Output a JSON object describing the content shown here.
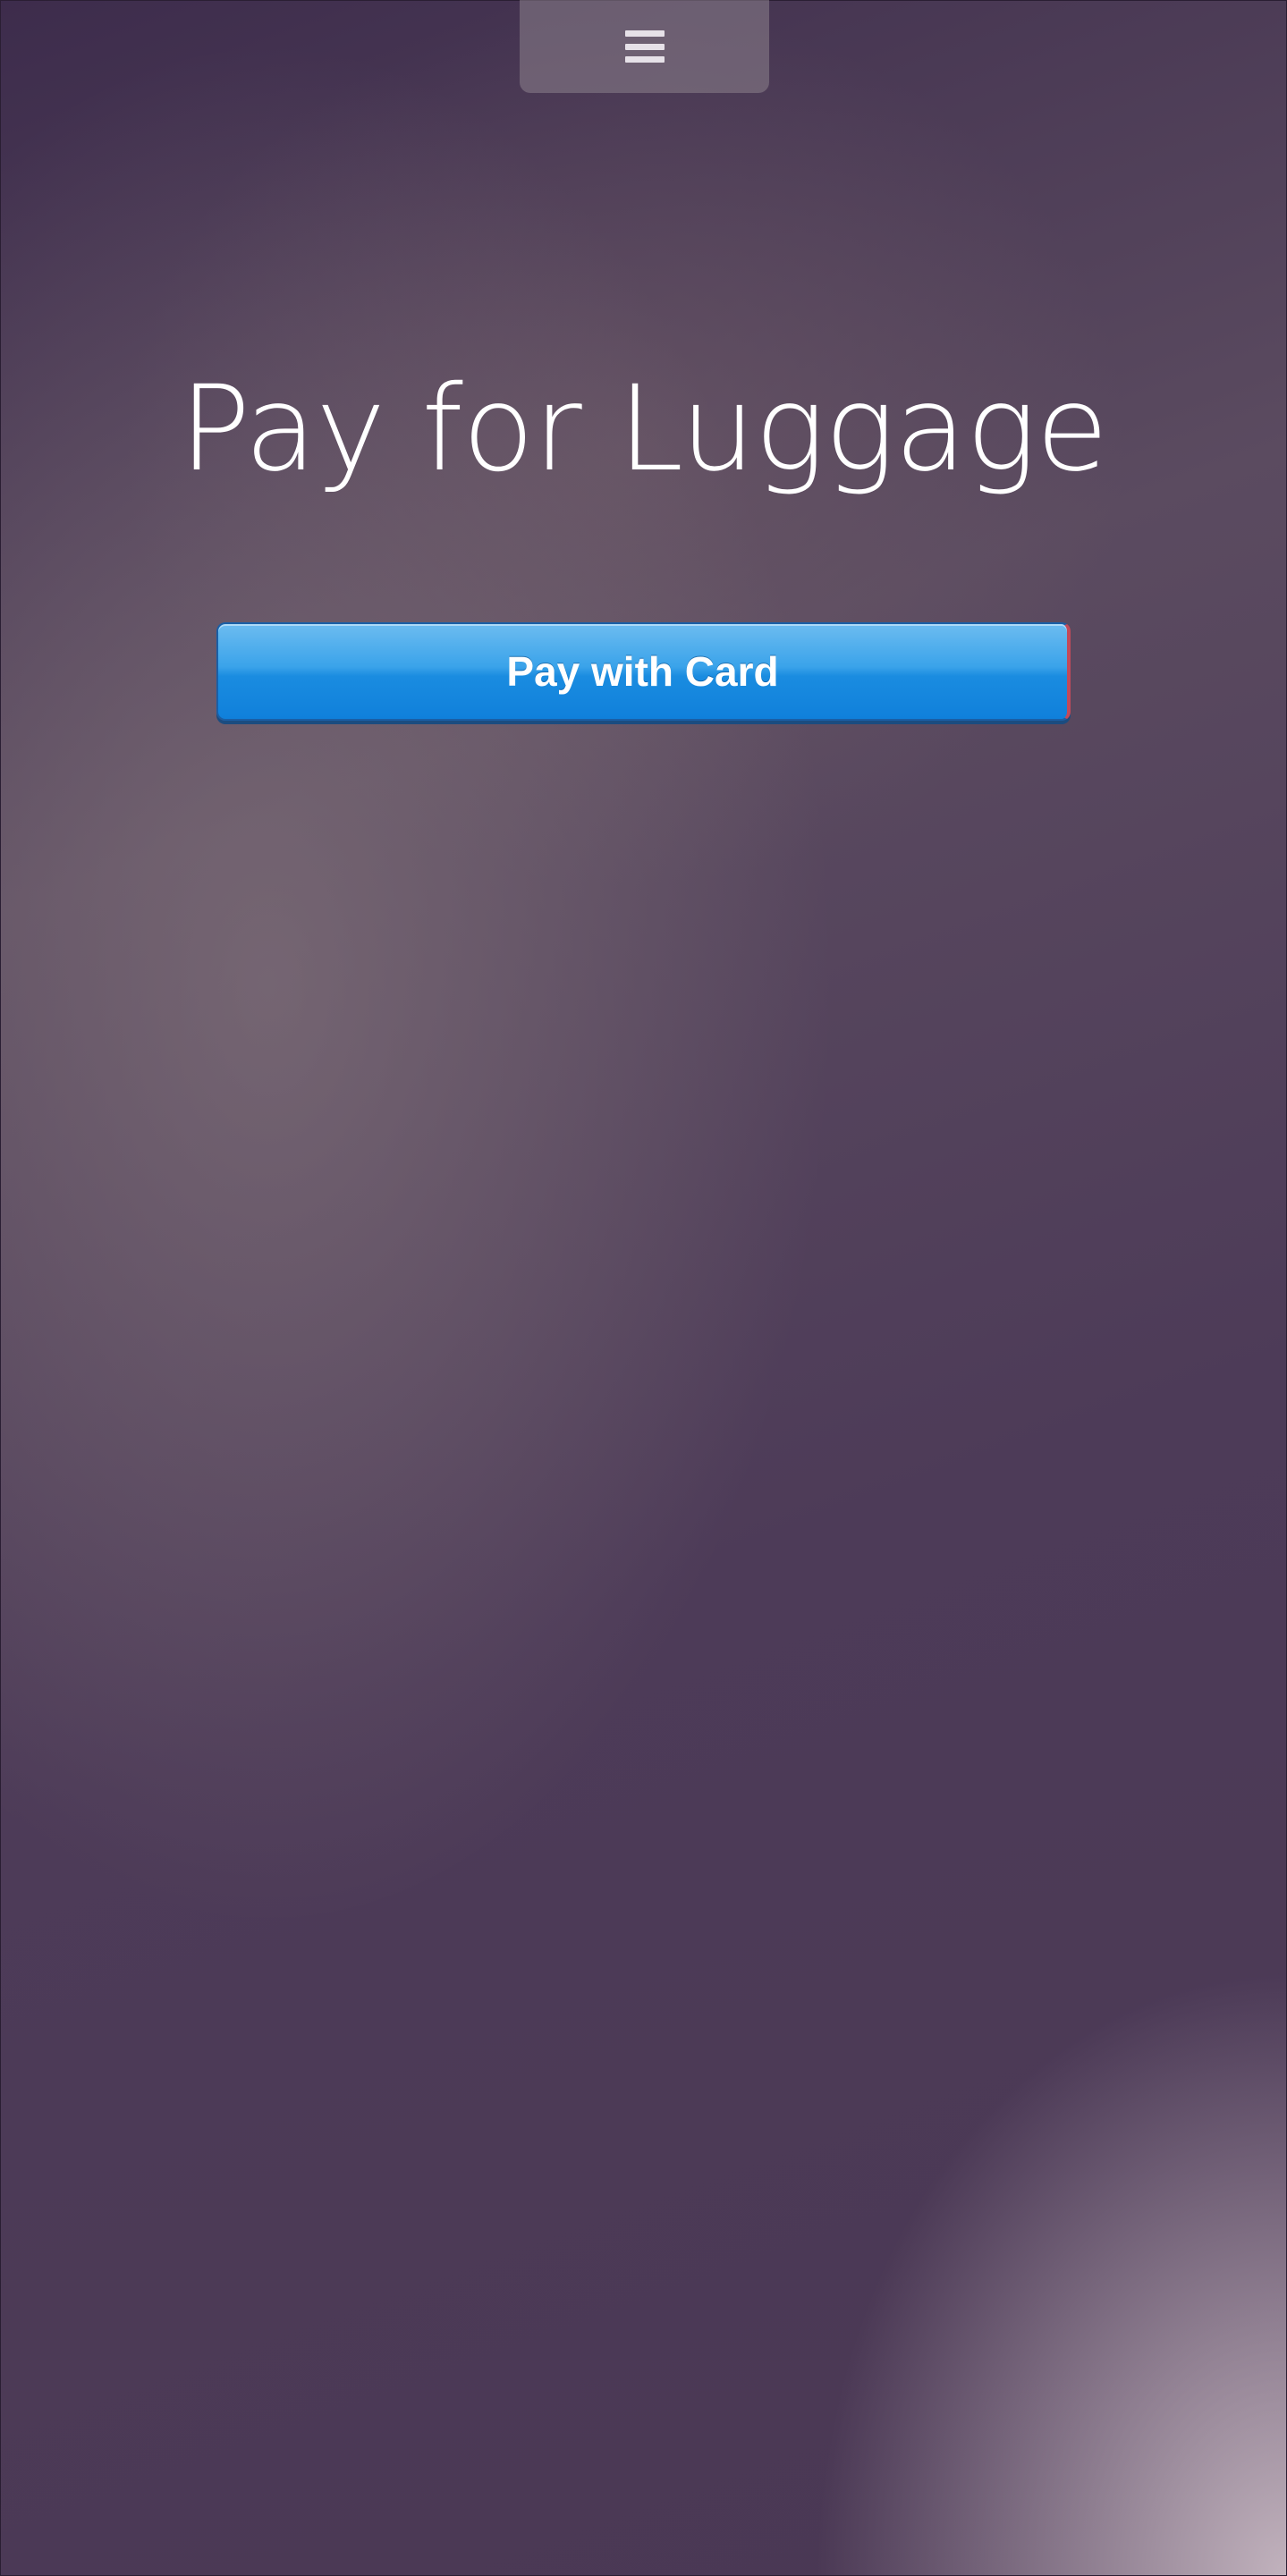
{
  "header": {
    "menu_icon": "hamburger-menu-icon"
  },
  "main": {
    "title": "Pay for Luggage",
    "pay_button_label": "Pay with Card"
  },
  "colors": {
    "button_primary": "#1a8ce0",
    "background": "#4a3a56",
    "title_text": "#ffffff"
  }
}
